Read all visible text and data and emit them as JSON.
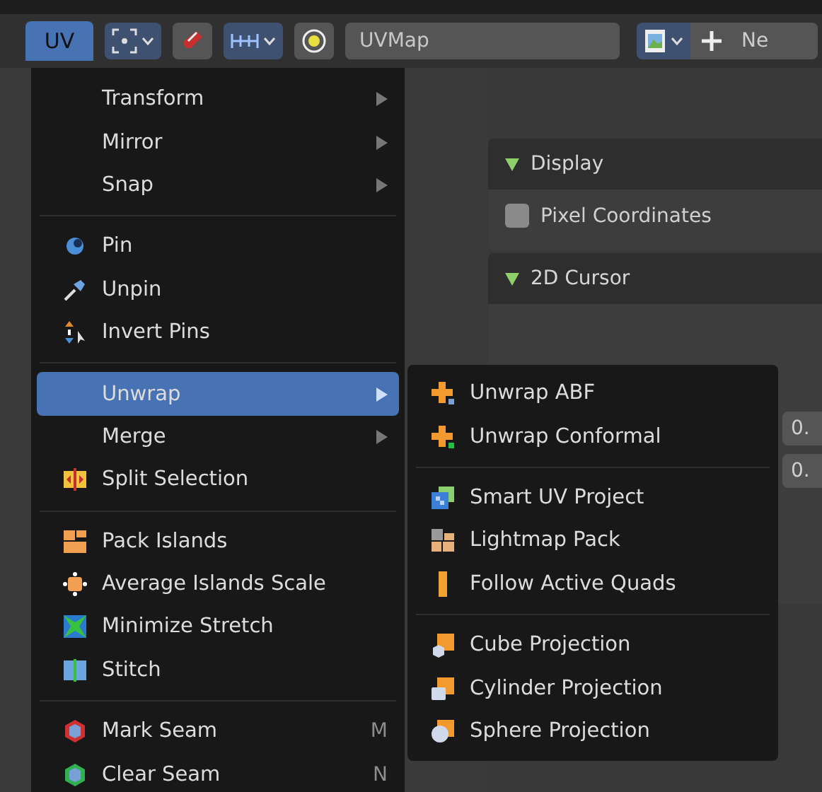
{
  "header": {
    "menu_button": {
      "label": "UV",
      "selected": true
    },
    "uv_map_field": {
      "value": "UVMap"
    },
    "new_button": {
      "label": "Ne"
    }
  },
  "sidebar": {
    "panels": [
      {
        "title": "Display",
        "expanded": true,
        "checkbox": {
          "label": "Pixel Coordinates",
          "checked": false
        }
      },
      {
        "title": "2D Cursor",
        "expanded": true,
        "values": [
          "0.",
          "0."
        ]
      }
    ]
  },
  "uv_menu": {
    "sections": [
      {
        "items": [
          {
            "label": "Transform",
            "submenu": true,
            "selected": false
          },
          {
            "label": "Mirror",
            "submenu": true,
            "selected": false
          },
          {
            "label": "Snap",
            "submenu": true,
            "selected": false
          }
        ]
      },
      {
        "items": [
          {
            "label": "Pin",
            "submenu": false,
            "selected": false
          },
          {
            "label": "Unpin",
            "submenu": false,
            "selected": false
          },
          {
            "label": "Invert Pins",
            "submenu": false,
            "selected": false
          }
        ]
      },
      {
        "items": [
          {
            "label": "Unwrap",
            "submenu": true,
            "selected": true
          },
          {
            "label": "Merge",
            "submenu": true,
            "selected": false
          },
          {
            "label": "Split Selection",
            "submenu": false,
            "selected": false
          }
        ]
      },
      {
        "items": [
          {
            "label": "Pack Islands",
            "submenu": false,
            "selected": false
          },
          {
            "label": "Average Islands Scale",
            "submenu": false,
            "selected": false
          },
          {
            "label": "Minimize Stretch",
            "submenu": false,
            "selected": false
          },
          {
            "label": "Stitch",
            "submenu": false,
            "selected": false
          }
        ]
      },
      {
        "items": [
          {
            "label": "Mark Seam",
            "shortcut": "M",
            "submenu": false,
            "selected": false
          },
          {
            "label": "Clear Seam",
            "shortcut": "N",
            "submenu": false,
            "selected": false
          }
        ]
      }
    ]
  },
  "unwrap_submenu": {
    "sections": [
      {
        "items": [
          {
            "label": "Unwrap ABF"
          },
          {
            "label": "Unwrap Conformal"
          }
        ]
      },
      {
        "items": [
          {
            "label": "Smart UV Project"
          },
          {
            "label": "Lightmap Pack"
          },
          {
            "label": "Follow Active Quads"
          }
        ]
      },
      {
        "items": [
          {
            "label": "Cube Projection"
          },
          {
            "label": "Cylinder Projection"
          },
          {
            "label": "Sphere Projection"
          }
        ]
      }
    ]
  }
}
